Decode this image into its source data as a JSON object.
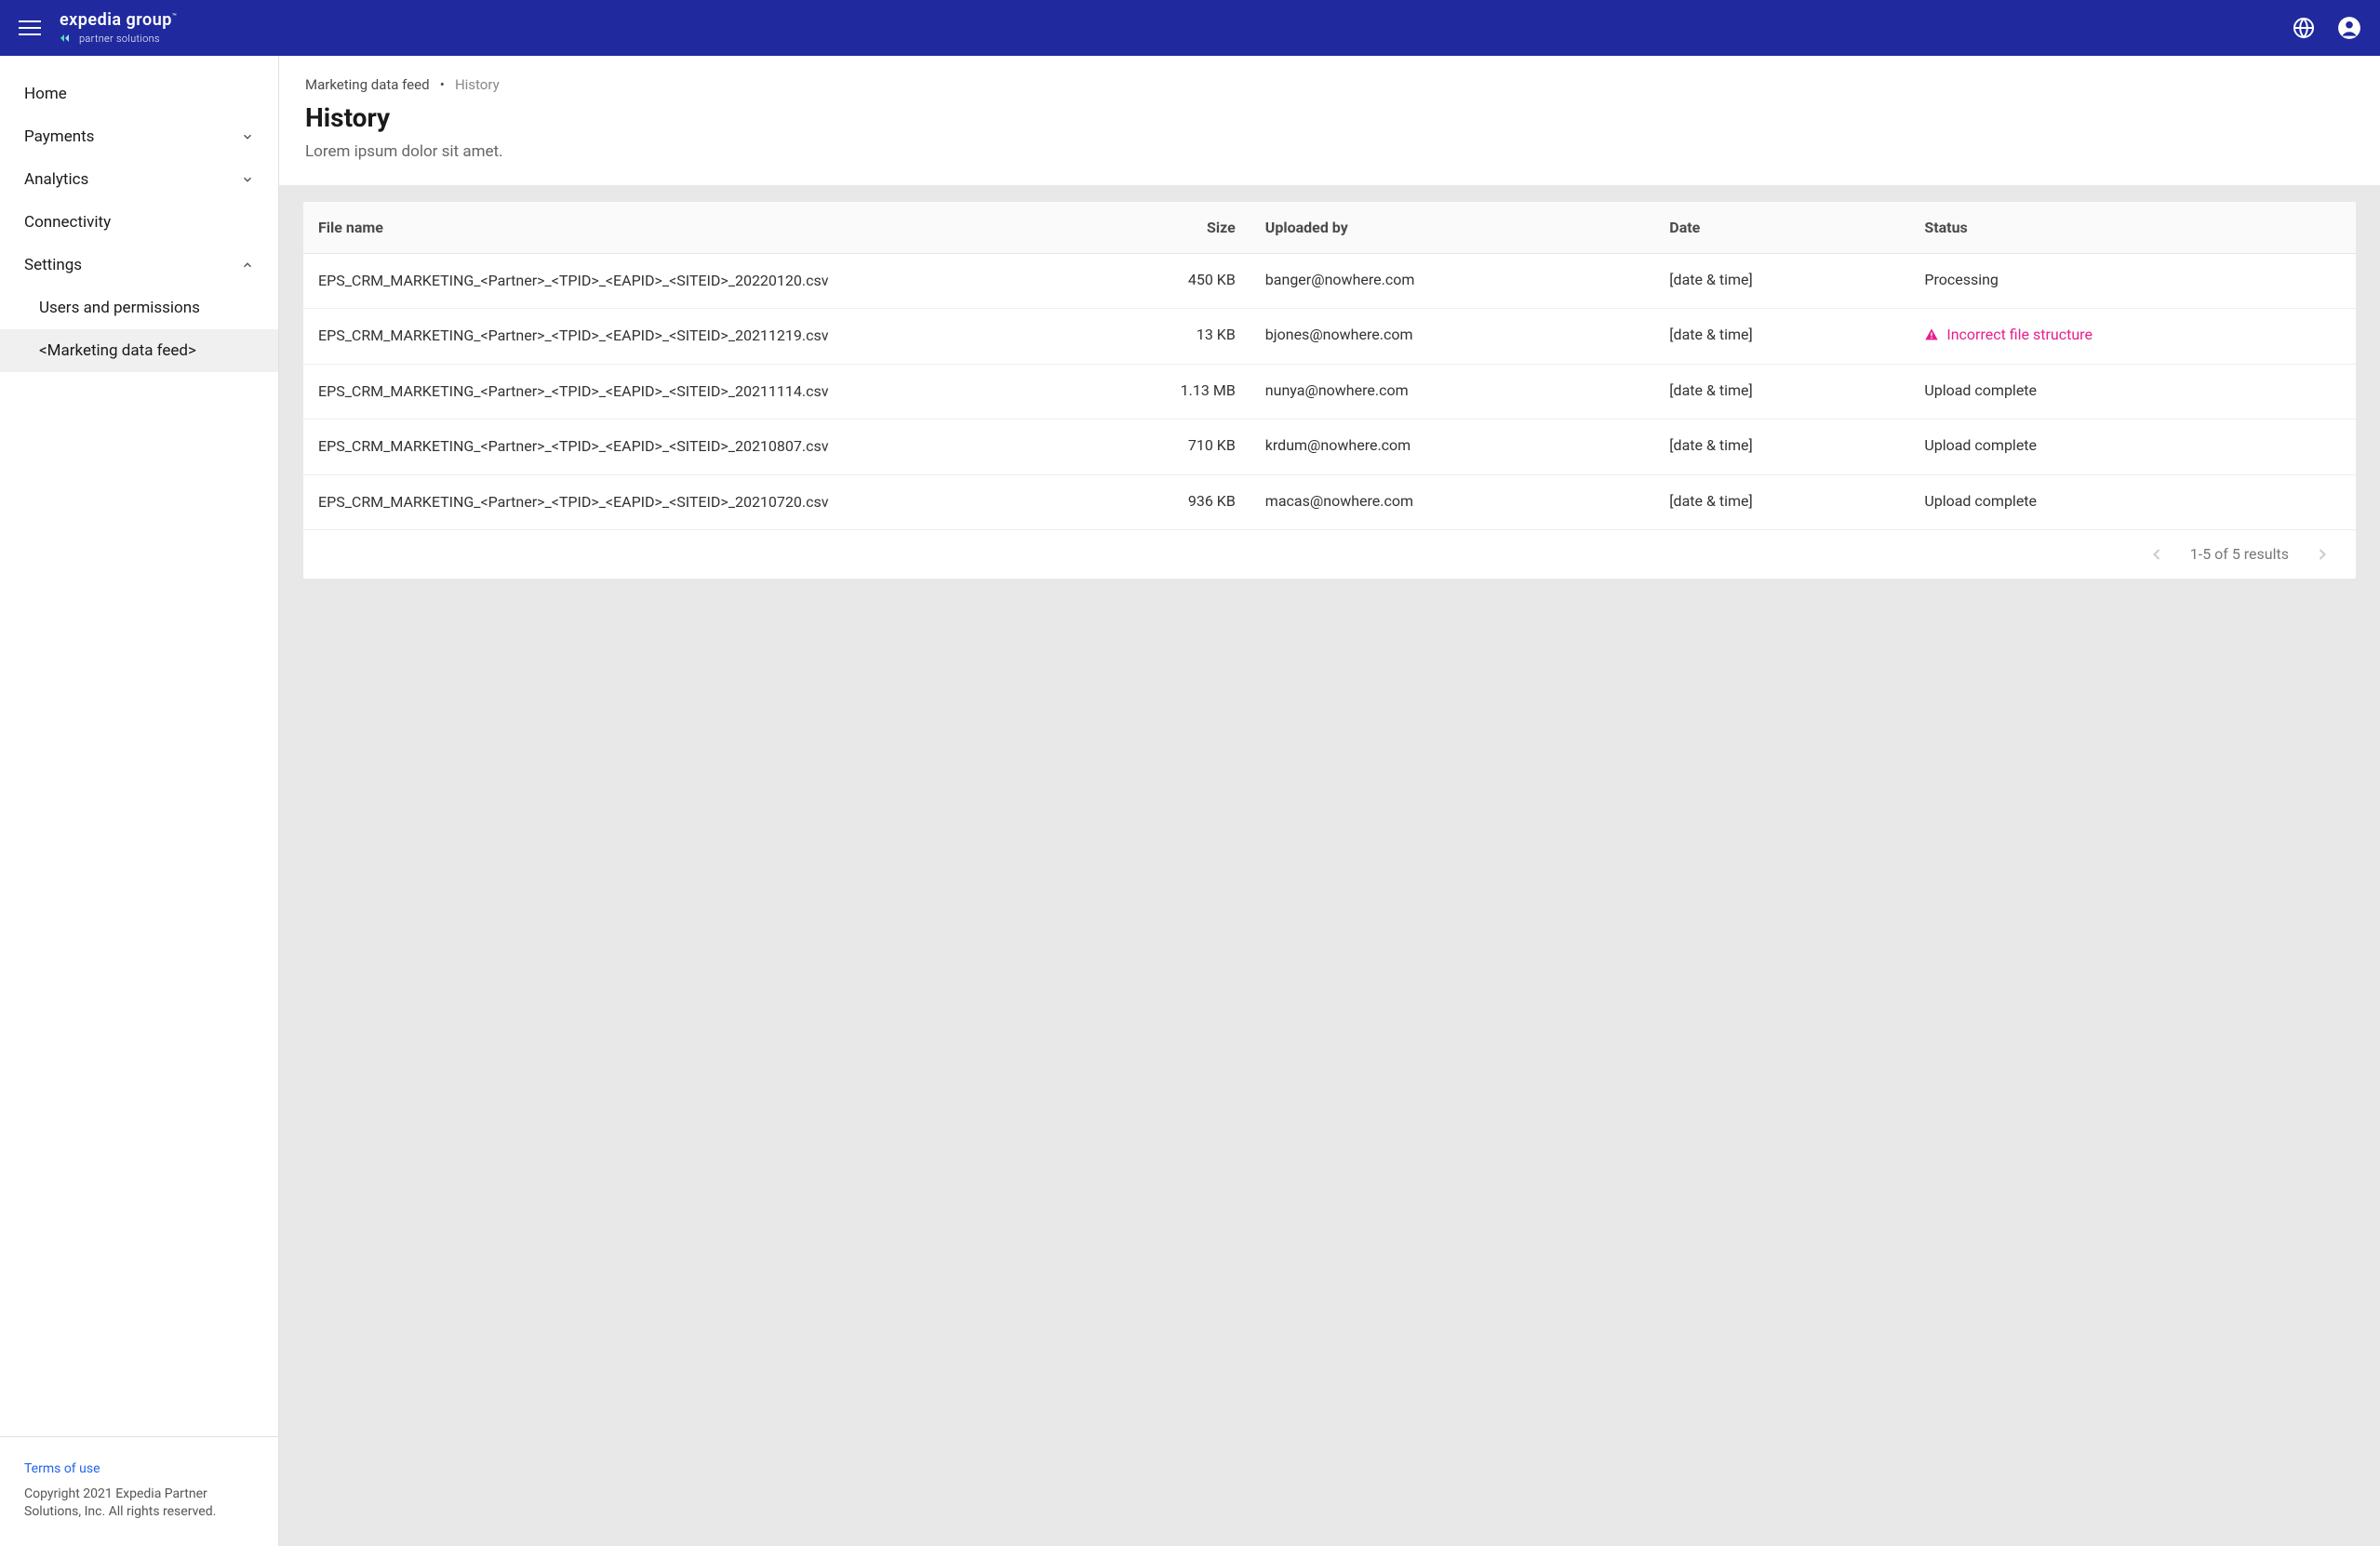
{
  "header": {
    "logo_top": "expedia group",
    "logo_bottom": "partner solutions"
  },
  "sidebar": {
    "items": [
      {
        "label": "Home",
        "expandable": false
      },
      {
        "label": "Payments",
        "expandable": true,
        "expanded": false
      },
      {
        "label": "Analytics",
        "expandable": true,
        "expanded": false
      },
      {
        "label": "Connectivity",
        "expandable": false
      },
      {
        "label": "Settings",
        "expandable": true,
        "expanded": true
      }
    ],
    "sub_items": [
      {
        "label": "Users and permissions",
        "active": false
      },
      {
        "label": "<Marketing data feed>",
        "active": true
      }
    ],
    "terms_link": "Terms of use",
    "copyright": "Copyright 2021 Expedia Partner Solutions, Inc. All rights reserved."
  },
  "breadcrumb": {
    "parent": "Marketing data feed",
    "separator": "•",
    "current": "History"
  },
  "page": {
    "title": "History",
    "subtitle": "Lorem ipsum dolor sit amet."
  },
  "table": {
    "headers": {
      "filename": "File name",
      "size": "Size",
      "uploaded_by": "Uploaded by",
      "date": "Date",
      "status": "Status"
    },
    "rows": [
      {
        "filename": "EPS_CRM_MARKETING_<Partner>_<TPID>_<EAPID>_<SITEID>_20220120.csv",
        "size": "450 KB",
        "uploaded_by": "banger@nowhere.com",
        "date": "[date & time]",
        "status": "Processing",
        "error": false
      },
      {
        "filename": "EPS_CRM_MARKETING_<Partner>_<TPID>_<EAPID>_<SITEID>_20211219.csv",
        "size": "13 KB",
        "uploaded_by": "bjones@nowhere.com",
        "date": "[date & time]",
        "status": "Incorrect file structure",
        "error": true
      },
      {
        "filename": "EPS_CRM_MARKETING_<Partner>_<TPID>_<EAPID>_<SITEID>_20211114.csv",
        "size": "1.13 MB",
        "uploaded_by": "nunya@nowhere.com",
        "date": "[date & time]",
        "status": "Upload complete",
        "error": false
      },
      {
        "filename": "EPS_CRM_MARKETING_<Partner>_<TPID>_<EAPID>_<SITEID>_20210807.csv",
        "size": "710 KB",
        "uploaded_by": "krdum@nowhere.com",
        "date": "[date & time]",
        "status": "Upload complete",
        "error": false
      },
      {
        "filename": "EPS_CRM_MARKETING_<Partner>_<TPID>_<EAPID>_<SITEID>_20210720.csv",
        "size": "936 KB",
        "uploaded_by": "macas@nowhere.com",
        "date": "[date & time]",
        "status": "Upload complete",
        "error": false
      }
    ]
  },
  "pagination": {
    "text": "1-5 of 5 results"
  }
}
